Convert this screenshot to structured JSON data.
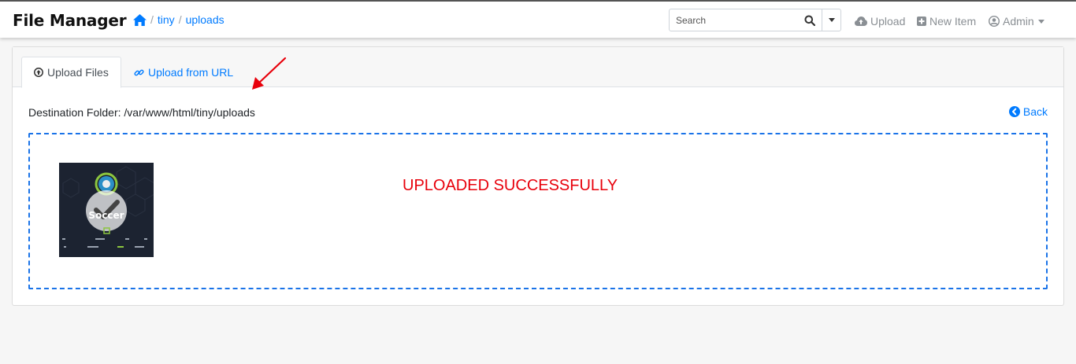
{
  "app": {
    "title": "File Manager"
  },
  "breadcrumb": {
    "items": [
      "tiny",
      "uploads"
    ],
    "separator": "/"
  },
  "search": {
    "placeholder": "Search"
  },
  "nav": {
    "upload": "Upload",
    "new_item": "New Item",
    "admin": "Admin"
  },
  "tabs": [
    {
      "label": "Upload Files",
      "icon": "upload-circle-icon",
      "active": true
    },
    {
      "label": "Upload from URL",
      "icon": "link-icon",
      "active": false
    }
  ],
  "content": {
    "destination_label": "Destination Folder: /var/www/html/tiny/uploads",
    "back_label": "Back",
    "status_message": "UPLOADED SUCCESSFULLY"
  },
  "thumbnail": {
    "caption": "Soccer"
  },
  "colors": {
    "link": "#007bff",
    "success_text": "#e8000b",
    "dropzone_border": "#1a73e8",
    "annotation_arrow": "#e8000b"
  }
}
